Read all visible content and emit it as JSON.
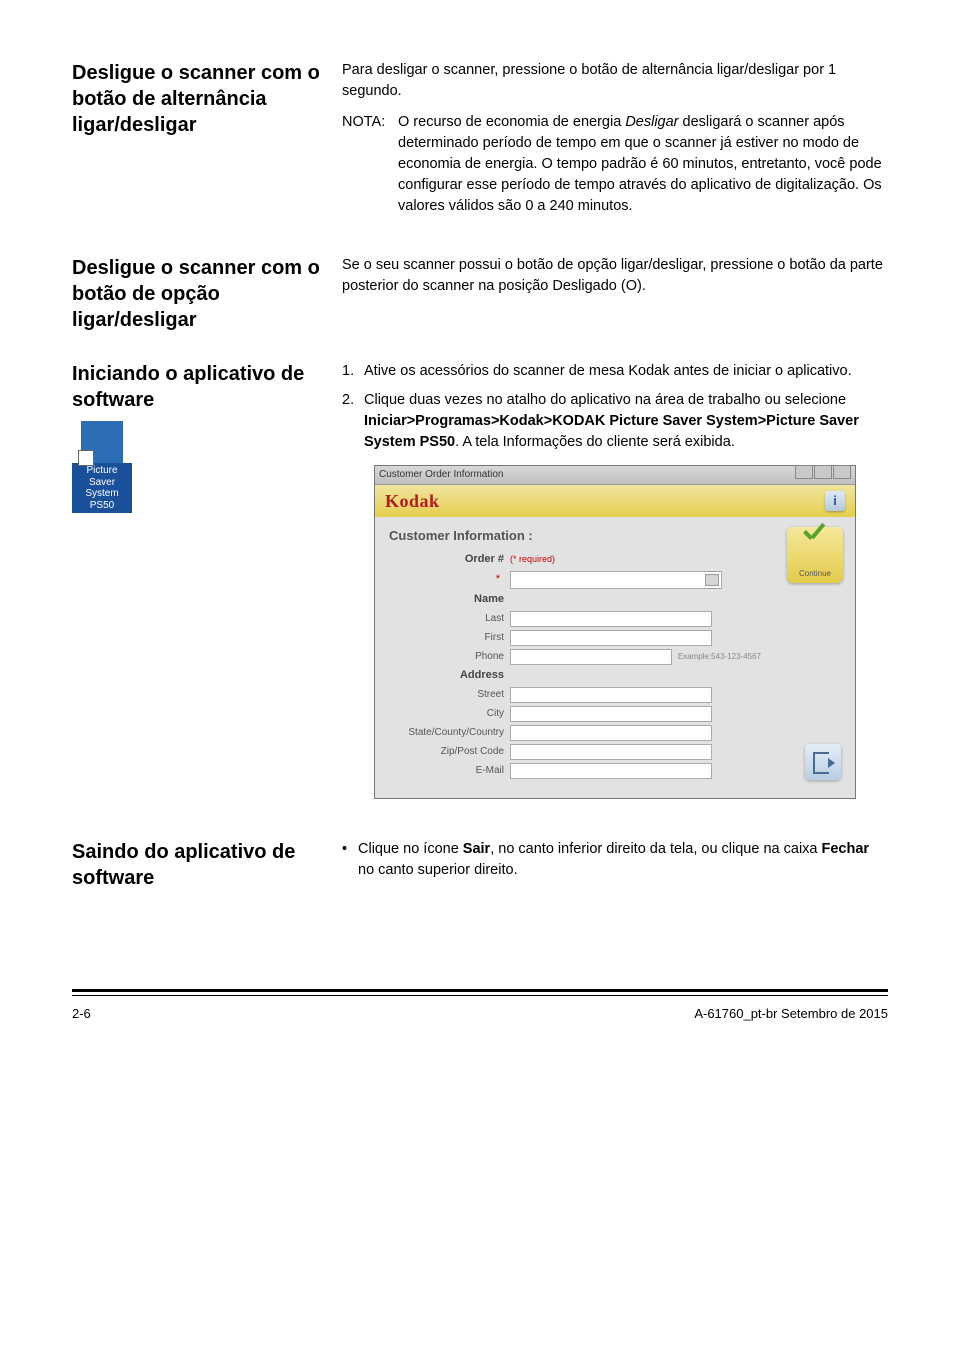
{
  "sections": {
    "s1": {
      "heading": "Desligue o scanner com o botão de alternância ligar/desligar",
      "p1": "Para desligar o scanner, pressione o botão de alternância ligar/desligar por 1 segundo.",
      "note_label": "NOTA:",
      "note_body_prefix": "O recurso de economia de energia ",
      "note_body_italic": "Desligar",
      "note_body_suffix": " desligará o scanner após determinado período de tempo em que o scanner já estiver no modo de economia de energia. O tempo padrão é 60 minutos, entretanto, você pode configurar esse período de tempo através do aplicativo de digitalização. Os valores válidos são 0 a 240 minutos."
    },
    "s2": {
      "heading": "Desligue o scanner com o botão de opção ligar/desligar",
      "p1": "Se o seu scanner possui o botão de opção ligar/desligar, pressione o botão da parte posterior do scanner na posição Desligado (O)."
    },
    "s3": {
      "heading": "Iniciando o aplicativo de software",
      "icon_label": "Picture Saver System PS50",
      "l1": "Ative os acessórios do scanner de mesa Kodak antes de iniciar o aplicativo.",
      "l2_prefix": "Clique duas vezes no atalho do aplicativo na área de trabalho ou selecione ",
      "l2_path": "Iniciar>Programas>Kodak>KODAK Picture Saver System>Picture Saver System PS50",
      "l2_suffix": ". A tela Informações do cliente será exibida."
    },
    "s4": {
      "heading": "Saindo do aplicativo de software",
      "bullet_prefix": "Clique no ícone ",
      "bullet_b1": "Sair",
      "bullet_mid": ", no canto inferior direito da tela, ou clique na caixa ",
      "bullet_b2": "Fechar",
      "bullet_suffix": " no canto superior direito."
    }
  },
  "dialog": {
    "title": "Customer Order Information",
    "brand": "Kodak",
    "section_title": "Customer Information :",
    "required": "(* required)",
    "continue": "Continue",
    "example": "Example:543-123-4567",
    "labels": {
      "order": "Order #",
      "name": "Name",
      "last": "Last",
      "first": "First",
      "phone": "Phone",
      "address": "Address",
      "street": "Street",
      "city": "City",
      "region": "State/County/Country",
      "zip": "Zip/Post Code",
      "email": "E-Mail"
    }
  },
  "footer": {
    "left": "2-6",
    "right": "A-61760_pt-br  Setembro de 2015"
  }
}
